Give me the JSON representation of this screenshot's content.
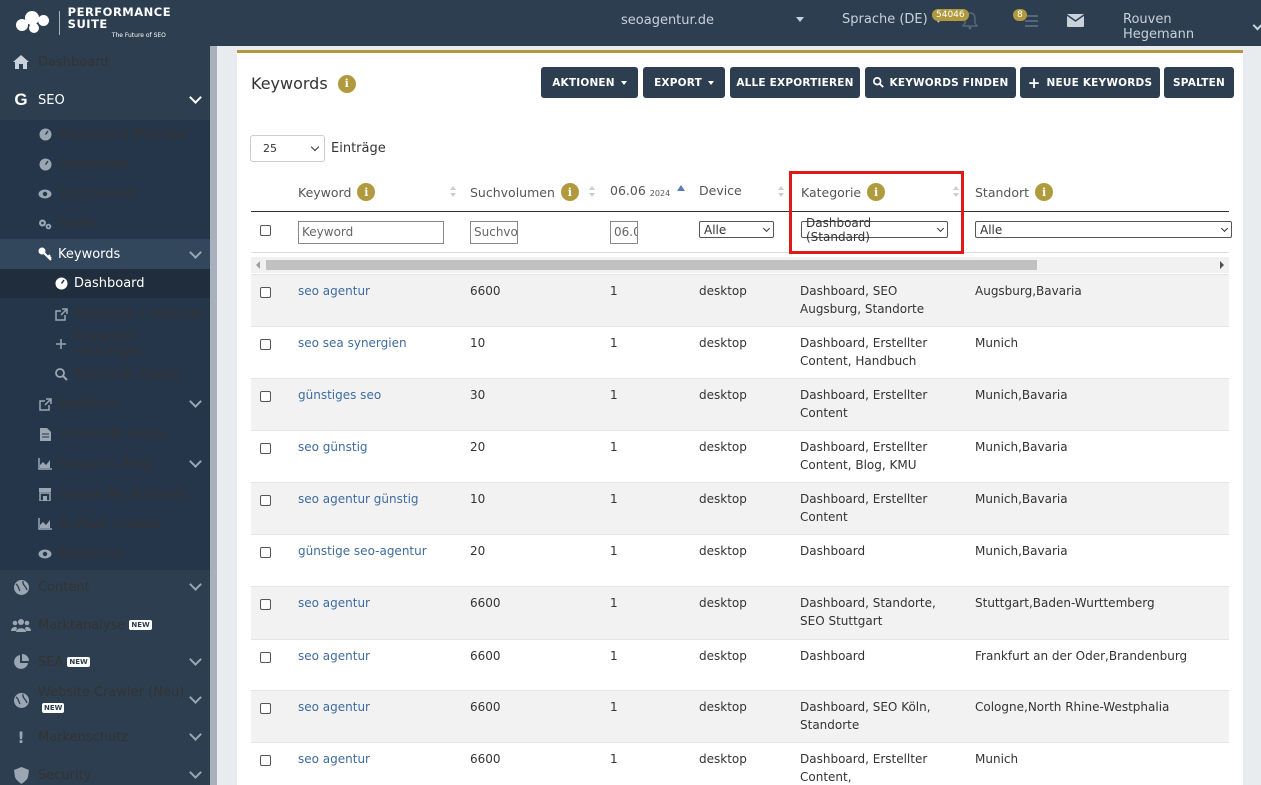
{
  "header": {
    "brand_title": "Performance Suite",
    "brand_subtitle": "The Future of SEO",
    "domain": "seoagentur.de",
    "language": "Sprache (DE)",
    "notification_count": "54046",
    "task_count": "8",
    "user_name": "Rouven Hegemann"
  },
  "sidebar": {
    "items": [
      {
        "label": "Dashboard",
        "icon": "home-icon"
      },
      {
        "label": "SEO",
        "icon": "google-g-icon"
      },
      {
        "label": "Dashboard Manager",
        "icon": "dashboard-gauge-icon"
      },
      {
        "label": "Dashboard",
        "icon": "dashboard-gauge-icon"
      },
      {
        "label": "Sichtbarkeit",
        "icon": "eye-icon"
      },
      {
        "label": "Traffic",
        "icon": "cogs-icon"
      },
      {
        "label": "Keywords",
        "icon": "key-icon"
      },
      {
        "label": "Dashboard",
        "icon": "dashboard-gauge-icon"
      },
      {
        "label": "Gewinner / Verlierer",
        "icon": "external-link-icon"
      },
      {
        "label": "Keywords hinzufügen",
        "icon": "plus-icon"
      },
      {
        "label": "Keywords finden",
        "icon": "search-icon"
      },
      {
        "label": "Backlinks",
        "icon": "external-link-icon"
      },
      {
        "label": "Indexierte Seiten",
        "icon": "file-icon"
      },
      {
        "label": "Google & Bing",
        "icon": "area-chart-icon"
      },
      {
        "label": "Google My Business",
        "icon": "store-icon"
      },
      {
        "label": "OnPage Crawler",
        "icon": "area-chart-icon"
      },
      {
        "label": "Robots.txt",
        "icon": "eye-icon"
      },
      {
        "label": "Content",
        "icon": "globe-icon"
      },
      {
        "label": "Marktanalyse",
        "icon": "users-icon",
        "tag": "NEW"
      },
      {
        "label": "SEA",
        "icon": "pie-chart-icon",
        "tag": "NEW"
      },
      {
        "label": "Website Crawler (Neu)",
        "icon": "globe-icon",
        "tag": "NEW"
      },
      {
        "label": "Markenschutz",
        "icon": "exclamation-icon"
      },
      {
        "label": "Security",
        "icon": "shield-icon"
      }
    ]
  },
  "page": {
    "title": "Keywords",
    "buttons": {
      "actions": "AKTIONEN",
      "export": "EXPORT",
      "export_all": "ALLE EXPORTIEREN",
      "find_keywords": "KEYWORDS FINDEN",
      "new_keywords": "NEUE KEYWORDS",
      "columns": "SPALTEN"
    },
    "page_size": "25",
    "entries_label": "Einträge"
  },
  "table": {
    "columns": {
      "keyword": "Keyword",
      "volume": "Suchvolumen",
      "date": "06.06",
      "date_year": "2024",
      "device": "Device",
      "category": "Kategorie",
      "location": "Standort"
    },
    "filters": {
      "keyword_placeholder": "Keyword",
      "volume_placeholder": "Suchvo",
      "date_placeholder": "06.0",
      "device_value": "Alle",
      "category_value": "Dashboard (Standard)",
      "location_value": "Alle"
    },
    "rows": [
      {
        "keyword": "seo agentur",
        "volume": "6600",
        "rank": "1",
        "device": "desktop",
        "category": "Dashboard, SEO Augsburg, Standorte",
        "location": "Augsburg,Bavaria"
      },
      {
        "keyword": "seo sea synergien",
        "volume": "10",
        "rank": "1",
        "device": "desktop",
        "category": "Dashboard, Erstellter Content, Handbuch",
        "location": "Munich"
      },
      {
        "keyword": "günstiges seo",
        "volume": "30",
        "rank": "1",
        "device": "desktop",
        "category": "Dashboard, Erstellter Content",
        "location": "Munich,Bavaria"
      },
      {
        "keyword": "seo günstig",
        "volume": "20",
        "rank": "1",
        "device": "desktop",
        "category": "Dashboard, Erstellter Content, Blog, KMU",
        "location": "Munich,Bavaria"
      },
      {
        "keyword": "seo agentur günstig",
        "volume": "10",
        "rank": "1",
        "device": "desktop",
        "category": "Dashboard, Erstellter Content",
        "location": "Munich,Bavaria"
      },
      {
        "keyword": "günstige seo-agentur",
        "volume": "20",
        "rank": "1",
        "device": "desktop",
        "category": "Dashboard",
        "location": "Munich,Bavaria"
      },
      {
        "keyword": "seo agentur",
        "volume": "6600",
        "rank": "1",
        "device": "desktop",
        "category": "Dashboard, Standorte, SEO Stuttgart",
        "location": "Stuttgart,Baden-Wurttemberg"
      },
      {
        "keyword": "seo agentur",
        "volume": "6600",
        "rank": "1",
        "device": "desktop",
        "category": "Dashboard",
        "location": "Frankfurt an der Oder,Brandenburg"
      },
      {
        "keyword": "seo agentur",
        "volume": "6600",
        "rank": "1",
        "device": "desktop",
        "category": "Dashboard, SEO Köln, Standorte",
        "location": "Cologne,North Rhine-Westphalia"
      },
      {
        "keyword": "seo agentur",
        "volume": "6600",
        "rank": "1",
        "device": "desktop",
        "category": "Dashboard, Erstellter Content,",
        "location": "Munich"
      }
    ]
  },
  "colors": {
    "navy": "#2c3e50",
    "gold": "#b19a3e",
    "highlight": "#e01818",
    "link": "#3e6ba0"
  }
}
